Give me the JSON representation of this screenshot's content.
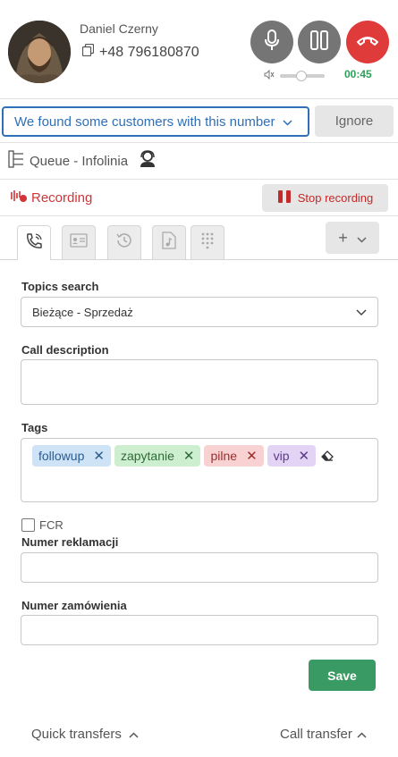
{
  "caller": {
    "name": "Daniel Czerny",
    "phone": "+48 796180870",
    "timer": "00:45"
  },
  "customers": {
    "notice": "We found some customers with this number",
    "ignore_label": "Ignore"
  },
  "queue": {
    "label": "Queue - Infolinia"
  },
  "recording": {
    "label": "Recording",
    "stop_label": "Stop recording"
  },
  "tabs": {
    "plus_label": "+"
  },
  "form": {
    "topics_label": "Topics search",
    "topics_value": "Bieżące - Sprzedaż",
    "call_desc_label": "Call description",
    "call_desc_value": "",
    "tags_label": "Tags",
    "tags": [
      {
        "text": "followup",
        "bg": "#cfe3f7",
        "fg": "#2c5d8f"
      },
      {
        "text": "zapytanie",
        "bg": "#cdeecf",
        "fg": "#2f6a3a"
      },
      {
        "text": "pilne",
        "bg": "#f8d2d2",
        "fg": "#9b2e2e"
      },
      {
        "text": "vip",
        "bg": "#e3d4f5",
        "fg": "#5b3b88"
      }
    ],
    "fcr_label": "FCR",
    "complaint_label": "Numer reklamacji",
    "complaint_value": "",
    "order_label": "Numer zamówienia",
    "order_value": "",
    "save_label": "Save"
  },
  "footer": {
    "quick_transfers": "Quick transfers",
    "call_transfer": "Call transfer"
  },
  "colors": {
    "accent_blue": "#2f6fb8",
    "hangup_red": "#e03b3b",
    "recording_red": "#d13438",
    "timer_green": "#2e9e5a",
    "save_green": "#3a9a63"
  }
}
